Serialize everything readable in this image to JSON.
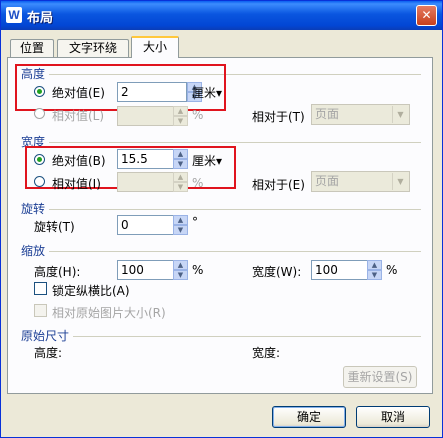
{
  "window": {
    "title": "布局",
    "app_icon": "W",
    "close_label": "✕"
  },
  "tabs": [
    {
      "label": "位置",
      "active": false
    },
    {
      "label": "文字环绕",
      "active": false
    },
    {
      "label": "大小",
      "active": true
    }
  ],
  "height": {
    "section_title": "高度",
    "absolute_label": "绝对值(E)",
    "absolute_value": "2",
    "unit": "厘米▾",
    "relative_label": "相对值(L)",
    "relative_value": "",
    "relative_unit": "%",
    "relative_to_label": "相对于(T)",
    "relative_to_value": "页面"
  },
  "width": {
    "section_title": "宽度",
    "absolute_label": "绝对值(B)",
    "absolute_value": "15.5",
    "unit": "厘米▾",
    "relative_label": "相对值(I)",
    "relative_value": "",
    "relative_unit": "%",
    "relative_to_label": "相对于(E)",
    "relative_to_value": "页面"
  },
  "rotation": {
    "section_title": "旋转",
    "label": "旋转(T)",
    "value": "0",
    "unit": "°"
  },
  "scale": {
    "section_title": "缩放",
    "height_label": "高度(H):",
    "height_value": "100",
    "height_unit": "%",
    "width_label": "宽度(W):",
    "width_value": "100",
    "width_unit": "%",
    "lock_label": "锁定纵横比(A)",
    "relative_original_label": "相对原始图片大小(R)"
  },
  "original": {
    "section_title": "原始尺寸",
    "height_label": "高度:",
    "width_label": "宽度:",
    "reset_label": "重新设置(S)"
  },
  "footer": {
    "ok_label": "确定",
    "cancel_label": "取消"
  },
  "colors": {
    "highlight": "#e0141e",
    "section_title": "#1c3f95",
    "titlebar": "#0a56e0"
  }
}
